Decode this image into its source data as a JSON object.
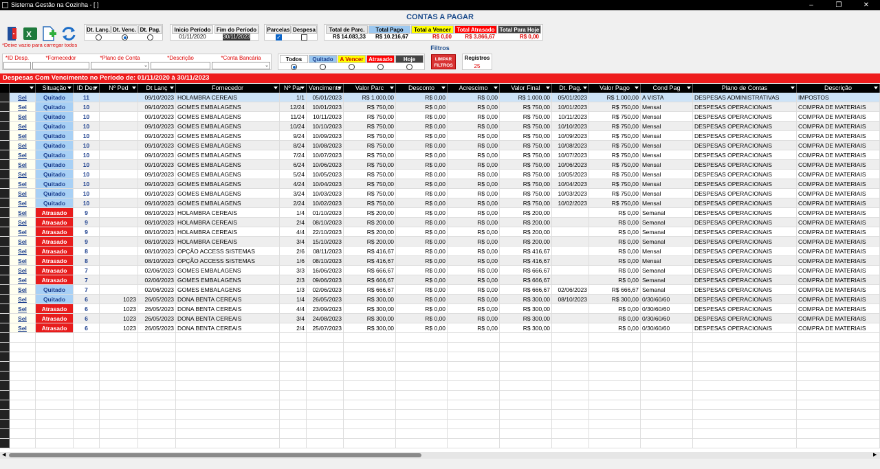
{
  "window": {
    "title": "Sistema Gestão na Cozinha - [ ]",
    "minimize": "–",
    "maximize": "❐",
    "close": "✕"
  },
  "page_title": "CONTAS A PAGAR",
  "date_type": {
    "labels": [
      "Dt. Lanç.",
      "Dt. Venc.",
      "Dt. Pag."
    ],
    "selected": 1
  },
  "period": {
    "start_label": "Inicio Período",
    "end_label": "Fim do Período",
    "start": "01/11/2020",
    "end": "30/11/2023"
  },
  "options": {
    "parcelas_label": "Parcelas",
    "despesa_label": "Despesa",
    "parcelas_checked": true,
    "despesa_checked": false
  },
  "totals": {
    "labels": [
      "Total de Parc.",
      "Total Pago",
      "Total a Vencer",
      "Total Atrasado",
      "Total Para Hoje"
    ],
    "values": [
      "R$ 14.083,33",
      "R$ 10.216,67",
      "R$ 0,00",
      "R$ 3.866,67",
      "R$ 0,00"
    ],
    "colors": [
      "#e8e8e8",
      "#9cc8f0",
      "#ffff00",
      "#ff0000",
      "#444444"
    ]
  },
  "filters": {
    "hint": "*Deixe vazio para carregar todos",
    "title": "Filtros",
    "fields": [
      "*ID Desp.",
      "*Fornecedor",
      "*Plano de Conta",
      "*Descrição",
      "*Conta Bancária"
    ],
    "status_labels": [
      "Todos",
      "Quitado",
      "A Vencer",
      "Atrasado",
      "Hoje"
    ],
    "status_selected": 0,
    "clear_button": "LIMPAR FILTROS",
    "registros_label": "Registros",
    "registros_value": "25"
  },
  "period_banner": "Despesas Com Vencimento no Período de: 01/11/2020 à 30/11/2023",
  "grid": {
    "columns": [
      "",
      "Situação",
      "ID Des",
      "Nº Ped",
      "Dt Lanç",
      "Fornecedor",
      "Nº Par",
      "Vencimento",
      "Valor Parc",
      "Desconto",
      "Acrescimo",
      "Valor Final",
      "Dt. Pag.",
      "Valor Pago",
      "Cond Pag",
      "Plano de Contas",
      "Descrição"
    ],
    "sel_label": "Sel",
    "status_colors": {
      "Quitado": "#a8d0f5",
      "Atrasado": "#e81c1c"
    },
    "rows": [
      [
        "Quitado",
        "11",
        "",
        "09/10/2023",
        "HOLAMBRA CEREAIS",
        "1/1",
        "05/01/2023",
        "R$ 1.000,00",
        "R$ 0,00",
        "R$ 0,00",
        "R$ 1.000,00",
        "05/01/2023",
        "R$ 1.000,00",
        "A VISTA",
        "DESPESAS ADMINISTRATIVAS",
        "IMPOSTOS"
      ],
      [
        "Quitado",
        "10",
        "",
        "09/10/2023",
        "GOMES EMBALAGENS",
        "12/24",
        "10/01/2023",
        "R$ 750,00",
        "R$ 0,00",
        "R$ 0,00",
        "R$ 750,00",
        "10/01/2023",
        "R$ 750,00",
        "Mensal",
        "DESPESAS OPERACIONAIS",
        "COMPRA DE MATERIAIS"
      ],
      [
        "Quitado",
        "10",
        "",
        "09/10/2023",
        "GOMES EMBALAGENS",
        "11/24",
        "10/11/2023",
        "R$ 750,00",
        "R$ 0,00",
        "R$ 0,00",
        "R$ 750,00",
        "10/11/2023",
        "R$ 750,00",
        "Mensal",
        "DESPESAS OPERACIONAIS",
        "COMPRA DE MATERIAIS"
      ],
      [
        "Quitado",
        "10",
        "",
        "09/10/2023",
        "GOMES EMBALAGENS",
        "10/24",
        "10/10/2023",
        "R$ 750,00",
        "R$ 0,00",
        "R$ 0,00",
        "R$ 750,00",
        "10/10/2023",
        "R$ 750,00",
        "Mensal",
        "DESPESAS OPERACIONAIS",
        "COMPRA DE MATERIAIS"
      ],
      [
        "Quitado",
        "10",
        "",
        "09/10/2023",
        "GOMES EMBALAGENS",
        "9/24",
        "10/09/2023",
        "R$ 750,00",
        "R$ 0,00",
        "R$ 0,00",
        "R$ 750,00",
        "10/09/2023",
        "R$ 750,00",
        "Mensal",
        "DESPESAS OPERACIONAIS",
        "COMPRA DE MATERIAIS"
      ],
      [
        "Quitado",
        "10",
        "",
        "09/10/2023",
        "GOMES EMBALAGENS",
        "8/24",
        "10/08/2023",
        "R$ 750,00",
        "R$ 0,00",
        "R$ 0,00",
        "R$ 750,00",
        "10/08/2023",
        "R$ 750,00",
        "Mensal",
        "DESPESAS OPERACIONAIS",
        "COMPRA DE MATERIAIS"
      ],
      [
        "Quitado",
        "10",
        "",
        "09/10/2023",
        "GOMES EMBALAGENS",
        "7/24",
        "10/07/2023",
        "R$ 750,00",
        "R$ 0,00",
        "R$ 0,00",
        "R$ 750,00",
        "10/07/2023",
        "R$ 750,00",
        "Mensal",
        "DESPESAS OPERACIONAIS",
        "COMPRA DE MATERIAIS"
      ],
      [
        "Quitado",
        "10",
        "",
        "09/10/2023",
        "GOMES EMBALAGENS",
        "6/24",
        "10/06/2023",
        "R$ 750,00",
        "R$ 0,00",
        "R$ 0,00",
        "R$ 750,00",
        "10/06/2023",
        "R$ 750,00",
        "Mensal",
        "DESPESAS OPERACIONAIS",
        "COMPRA DE MATERIAIS"
      ],
      [
        "Quitado",
        "10",
        "",
        "09/10/2023",
        "GOMES EMBALAGENS",
        "5/24",
        "10/05/2023",
        "R$ 750,00",
        "R$ 0,00",
        "R$ 0,00",
        "R$ 750,00",
        "10/05/2023",
        "R$ 750,00",
        "Mensal",
        "DESPESAS OPERACIONAIS",
        "COMPRA DE MATERIAIS"
      ],
      [
        "Quitado",
        "10",
        "",
        "09/10/2023",
        "GOMES EMBALAGENS",
        "4/24",
        "10/04/2023",
        "R$ 750,00",
        "R$ 0,00",
        "R$ 0,00",
        "R$ 750,00",
        "10/04/2023",
        "R$ 750,00",
        "Mensal",
        "DESPESAS OPERACIONAIS",
        "COMPRA DE MATERIAIS"
      ],
      [
        "Quitado",
        "10",
        "",
        "09/10/2023",
        "GOMES EMBALAGENS",
        "3/24",
        "10/03/2023",
        "R$ 750,00",
        "R$ 0,00",
        "R$ 0,00",
        "R$ 750,00",
        "10/03/2023",
        "R$ 750,00",
        "Mensal",
        "DESPESAS OPERACIONAIS",
        "COMPRA DE MATERIAIS"
      ],
      [
        "Quitado",
        "10",
        "",
        "09/10/2023",
        "GOMES EMBALAGENS",
        "2/24",
        "10/02/2023",
        "R$ 750,00",
        "R$ 0,00",
        "R$ 0,00",
        "R$ 750,00",
        "10/02/2023",
        "R$ 750,00",
        "Mensal",
        "DESPESAS OPERACIONAIS",
        "COMPRA DE MATERIAIS"
      ],
      [
        "Atrasado",
        "9",
        "",
        "08/10/2023",
        "HOLAMBRA CEREAIS",
        "1/4",
        "01/10/2023",
        "R$ 200,00",
        "R$ 0,00",
        "R$ 0,00",
        "R$ 200,00",
        "",
        "R$ 0,00",
        "Semanal",
        "DESPESAS OPERACIONAIS",
        "COMPRA DE MATERIAIS"
      ],
      [
        "Atrasado",
        "9",
        "",
        "08/10/2023",
        "HOLAMBRA CEREAIS",
        "2/4",
        "08/10/2023",
        "R$ 200,00",
        "R$ 0,00",
        "R$ 0,00",
        "R$ 200,00",
        "",
        "R$ 0,00",
        "Semanal",
        "DESPESAS OPERACIONAIS",
        "COMPRA DE MATERIAIS"
      ],
      [
        "Atrasado",
        "9",
        "",
        "08/10/2023",
        "HOLAMBRA CEREAIS",
        "4/4",
        "22/10/2023",
        "R$ 200,00",
        "R$ 0,00",
        "R$ 0,00",
        "R$ 200,00",
        "",
        "R$ 0,00",
        "Semanal",
        "DESPESAS OPERACIONAIS",
        "COMPRA DE MATERIAIS"
      ],
      [
        "Atrasado",
        "9",
        "",
        "08/10/2023",
        "HOLAMBRA CEREAIS",
        "3/4",
        "15/10/2023",
        "R$ 200,00",
        "R$ 0,00",
        "R$ 0,00",
        "R$ 200,00",
        "",
        "R$ 0,00",
        "Semanal",
        "DESPESAS OPERACIONAIS",
        "COMPRA DE MATERIAIS"
      ],
      [
        "Atrasado",
        "8",
        "",
        "08/10/2023",
        "OPÇÃO ACCESS SISTEMAS",
        "2/6",
        "08/11/2023",
        "R$ 416,67",
        "R$ 0,00",
        "R$ 0,00",
        "R$ 416,67",
        "",
        "R$ 0,00",
        "Mensal",
        "DESPESAS OPERACIONAIS",
        "COMPRA DE MATERIAIS"
      ],
      [
        "Atrasado",
        "8",
        "",
        "08/10/2023",
        "OPÇÃO ACCESS SISTEMAS",
        "1/6",
        "08/10/2023",
        "R$ 416,67",
        "R$ 0,00",
        "R$ 0,00",
        "R$ 416,67",
        "",
        "R$ 0,00",
        "Mensal",
        "DESPESAS OPERACIONAIS",
        "COMPRA DE MATERIAIS"
      ],
      [
        "Atrasado",
        "7",
        "",
        "02/06/2023",
        "GOMES EMBALAGENS",
        "3/3",
        "16/06/2023",
        "R$ 666,67",
        "R$ 0,00",
        "R$ 0,00",
        "R$ 666,67",
        "",
        "R$ 0,00",
        "Semanal",
        "DESPESAS OPERACIONAIS",
        "COMPRA DE MATERIAIS"
      ],
      [
        "Atrasado",
        "7",
        "",
        "02/06/2023",
        "GOMES EMBALAGENS",
        "2/3",
        "09/06/2023",
        "R$ 666,67",
        "R$ 0,00",
        "R$ 0,00",
        "R$ 666,67",
        "",
        "R$ 0,00",
        "Semanal",
        "DESPESAS OPERACIONAIS",
        "COMPRA DE MATERIAIS"
      ],
      [
        "Quitado",
        "7",
        "",
        "02/06/2023",
        "GOMES EMBALAGENS",
        "1/3",
        "02/06/2023",
        "R$ 666,67",
        "R$ 0,00",
        "R$ 0,00",
        "R$ 666,67",
        "02/06/2023",
        "R$ 666,67",
        "Semanal",
        "DESPESAS OPERACIONAIS",
        "COMPRA DE MATERIAIS"
      ],
      [
        "Quitado",
        "6",
        "1023",
        "26/05/2023",
        "DONA BENTA CEREAIS",
        "1/4",
        "26/05/2023",
        "R$ 300,00",
        "R$ 0,00",
        "R$ 0,00",
        "R$ 300,00",
        "08/10/2023",
        "R$ 300,00",
        "0/30/60/60",
        "DESPESAS OPERACIONAIS",
        "COMPRA DE MATERIAIS"
      ],
      [
        "Atrasado",
        "6",
        "1023",
        "26/05/2023",
        "DONA BENTA CEREAIS",
        "4/4",
        "23/09/2023",
        "R$ 300,00",
        "R$ 0,00",
        "R$ 0,00",
        "R$ 300,00",
        "",
        "R$ 0,00",
        "0/30/60/60",
        "DESPESAS OPERACIONAIS",
        "COMPRA DE MATERIAIS"
      ],
      [
        "Atrasado",
        "6",
        "1023",
        "26/05/2023",
        "DONA BENTA CEREAIS",
        "3/4",
        "24/08/2023",
        "R$ 300,00",
        "R$ 0,00",
        "R$ 0,00",
        "R$ 300,00",
        "",
        "R$ 0,00",
        "0/30/60/60",
        "DESPESAS OPERACIONAIS",
        "COMPRA DE MATERIAIS"
      ],
      [
        "Atrasado",
        "6",
        "1023",
        "26/05/2023",
        "DONA BENTA CEREAIS",
        "2/4",
        "25/07/2023",
        "R$ 300,00",
        "R$ 0,00",
        "R$ 0,00",
        "R$ 300,00",
        "",
        "R$ 0,00",
        "0/30/60/60",
        "DESPESAS OPERACIONAIS",
        "COMPRA DE MATERIAIS"
      ]
    ]
  }
}
